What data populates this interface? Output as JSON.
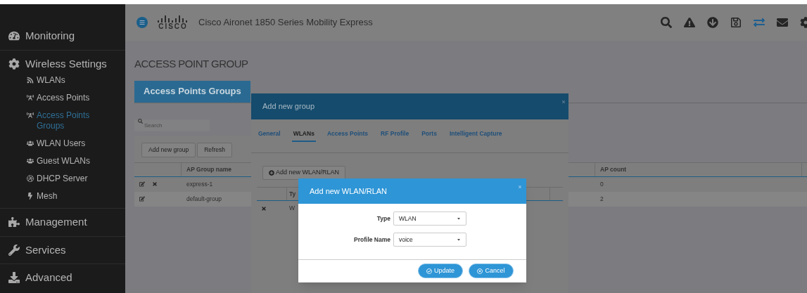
{
  "sidebar": {
    "items": [
      {
        "label": "Monitoring",
        "selected": false
      },
      {
        "label": "Wireless Settings",
        "selected": false,
        "children": [
          {
            "label": "WLANs",
            "selected": false
          },
          {
            "label": "Access Points",
            "selected": false
          },
          {
            "label": "Access Points Groups",
            "selected": true
          },
          {
            "label": "WLAN Users",
            "selected": false
          },
          {
            "label": "Guest WLANs",
            "selected": false
          },
          {
            "label": "DHCP Server",
            "selected": false
          },
          {
            "label": "Mesh",
            "selected": false
          }
        ]
      },
      {
        "label": "Management",
        "selected": false
      },
      {
        "label": "Services",
        "selected": false
      },
      {
        "label": "Advanced",
        "selected": false
      }
    ]
  },
  "header": {
    "logo_text": "CISCO",
    "title": "Cisco Aironet 1850 Series Mobility Express",
    "toolbar": [
      {
        "selected": false
      },
      {
        "selected": false
      },
      {
        "selected": false
      },
      {
        "selected": false
      },
      {
        "selected": true
      },
      {
        "selected": false
      },
      {
        "selected": false
      }
    ]
  },
  "page": {
    "title": "ACCESS POINT GROUP",
    "tabs": [
      {
        "label": "Access Points Groups",
        "selected": true
      }
    ],
    "search": {
      "placeholder": "Search"
    },
    "buttons": [
      "Add new group",
      "Refresh"
    ],
    "table": {
      "columns": [
        "AP Group name",
        "AP count"
      ],
      "rows": [
        {
          "name": "express-1",
          "count": "0",
          "deletable": true
        },
        {
          "name": "default-group",
          "count": "2",
          "deletable": false
        }
      ]
    }
  },
  "group_dialog": {
    "title": "Add new group",
    "tabs": [
      {
        "label": "General",
        "selected": false
      },
      {
        "label": "WLANs",
        "selected": true
      },
      {
        "label": "Access Points",
        "selected": false
      },
      {
        "label": "RF Profile",
        "selected": false
      },
      {
        "label": "Ports",
        "selected": false
      },
      {
        "label": "Intelligent Capture",
        "selected": false
      }
    ],
    "add_button": "Add new WLAN/RLAN",
    "table": {
      "column_2": "Ty",
      "rows": [
        {
          "column_2": "W"
        }
      ]
    }
  },
  "wlan_dialog": {
    "title": "Add new WLAN/RLAN",
    "fields": [
      {
        "label": "Type",
        "value": "WLAN"
      },
      {
        "label": "Profile Name",
        "value": "voice"
      }
    ],
    "buttons": [
      {
        "kind": "confirm",
        "label": "Update"
      },
      {
        "kind": "cancel",
        "label": "Cancel"
      }
    ]
  }
}
